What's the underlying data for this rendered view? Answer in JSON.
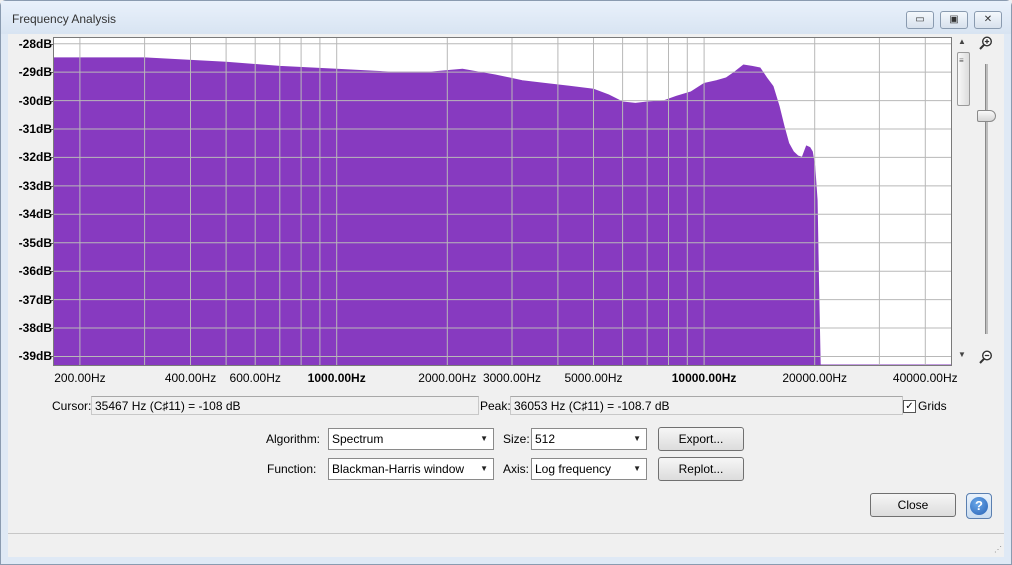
{
  "window": {
    "title": "Frequency Analysis",
    "minimize_glyph": "▭",
    "maximize_glyph": "▣",
    "close_glyph": "✕"
  },
  "chart_data": {
    "type": "area",
    "title": "",
    "xlabel": "",
    "ylabel": "",
    "x_scale": "log",
    "xlim": [
      170,
      47000
    ],
    "ylim": [
      -39.3,
      -27.8
    ],
    "grid": true,
    "fill_color": "#873ac0",
    "y_ticks": [
      "-28dB",
      "-29dB",
      "-30dB",
      "-31dB",
      "-32dB",
      "-33dB",
      "-34dB",
      "-35dB",
      "-36dB",
      "-37dB",
      "-38dB",
      "-39dB"
    ],
    "y_tick_values": [
      -28,
      -29,
      -30,
      -31,
      -32,
      -33,
      -34,
      -35,
      -36,
      -37,
      -38,
      -39
    ],
    "bold_y_ticks": [
      -28,
      -30,
      -32,
      -34,
      -36,
      -38
    ],
    "x_ticks": [
      {
        "value": 200,
        "label": "200.00Hz",
        "bold": false
      },
      {
        "value": 400,
        "label": "400.00Hz",
        "bold": false
      },
      {
        "value": 600,
        "label": "600.00Hz",
        "bold": false
      },
      {
        "value": 1000,
        "label": "1000.00Hz",
        "bold": true
      },
      {
        "value": 2000,
        "label": "2000.00Hz",
        "bold": false
      },
      {
        "value": 3000,
        "label": "3000.00Hz",
        "bold": false
      },
      {
        "value": 5000,
        "label": "5000.00Hz",
        "bold": false
      },
      {
        "value": 10000,
        "label": "10000.00Hz",
        "bold": true
      },
      {
        "value": 20000,
        "label": "20000.00Hz",
        "bold": false
      },
      {
        "value": 40000,
        "label": "40000.00Hz",
        "bold": false
      }
    ],
    "grid_x_values": [
      200,
      300,
      400,
      500,
      600,
      700,
      800,
      900,
      1000,
      2000,
      3000,
      4000,
      5000,
      6000,
      7000,
      8000,
      9000,
      10000,
      20000,
      30000,
      40000
    ],
    "x": [
      170,
      300,
      500,
      700,
      1000,
      1400,
      1800,
      2200,
      2700,
      3200,
      3700,
      4300,
      5000,
      5500,
      6000,
      6500,
      7000,
      7800,
      8400,
      9200,
      10000,
      10800,
      11500,
      12100,
      12800,
      13500,
      14200,
      14800,
      15400,
      16000,
      16500,
      17000,
      17500,
      18000,
      18500,
      19000,
      19400,
      19700,
      20000,
      20300,
      20500,
      20700,
      47000
    ],
    "y": [
      -28.5,
      -28.5,
      -28.65,
      -28.8,
      -28.9,
      -29.0,
      -29.0,
      -28.9,
      -29.1,
      -29.3,
      -29.4,
      -29.5,
      -29.6,
      -29.8,
      -30.05,
      -30.1,
      -30.05,
      -30.0,
      -29.85,
      -29.7,
      -29.4,
      -29.3,
      -29.2,
      -29.0,
      -28.75,
      -28.8,
      -28.85,
      -29.2,
      -29.5,
      -30.2,
      -30.9,
      -31.5,
      -31.8,
      -31.95,
      -32.0,
      -31.6,
      -31.65,
      -31.8,
      -32.3,
      -33.5,
      -36.5,
      -39.3,
      -39.3
    ]
  },
  "zoom": {
    "zoom_in_icon": "zoom-in-icon",
    "zoom_out_icon": "zoom-out-icon",
    "scroll_up_glyph": "▲",
    "scroll_down_glyph": "▼",
    "grip_glyph": "≡"
  },
  "status": {
    "cursor_label": "Cursor:",
    "cursor_value": "35467 Hz (C♯11) = -108 dB",
    "peak_label": "Peak:",
    "peak_value": "36053 Hz (C♯11) = -108.7 dB",
    "grids_label": "Grids",
    "grids_checked": "✓"
  },
  "controls": {
    "algorithm_label": "Algorithm:",
    "algorithm_value": "Spectrum",
    "function_label": "Function:",
    "function_value": "Blackman-Harris window",
    "size_label": "Size:",
    "size_value": "512",
    "axis_label": "Axis:",
    "axis_value": "Log frequency",
    "export_label": "Export...",
    "replot_label": "Replot...",
    "close_label": "Close",
    "help_glyph": "?",
    "caret_glyph": "▼"
  },
  "footer": {
    "resize_glyph": "⋰"
  }
}
